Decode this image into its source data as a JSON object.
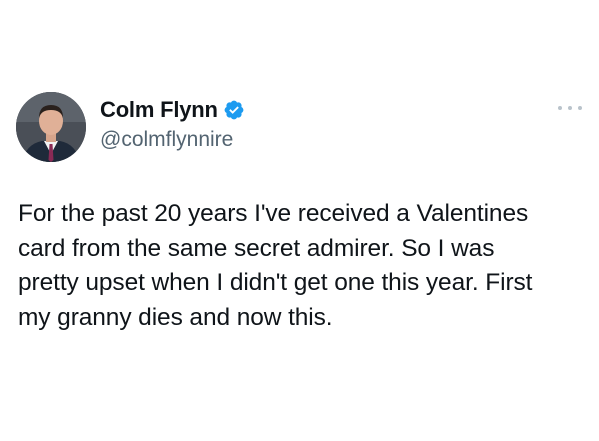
{
  "author": {
    "display_name": "Colm Flynn",
    "handle": "@colmflynnire",
    "verified": true,
    "avatar_icon": "profile-photo",
    "verified_icon": "verified-badge-icon",
    "verified_color": "#1d9bf0"
  },
  "menu": {
    "more_icon": "more-options-icon"
  },
  "tweet": {
    "lines": [
      "For the past 20 years I've received a Valentines",
      "card from the same secret admirer. So I was",
      "pretty upset when I didn't get one this year. First",
      "my granny dies and now this."
    ]
  },
  "colors": {
    "text": "#0f1419",
    "secondary_text": "#536471",
    "accent": "#1d9bf0",
    "background": "#ffffff"
  }
}
